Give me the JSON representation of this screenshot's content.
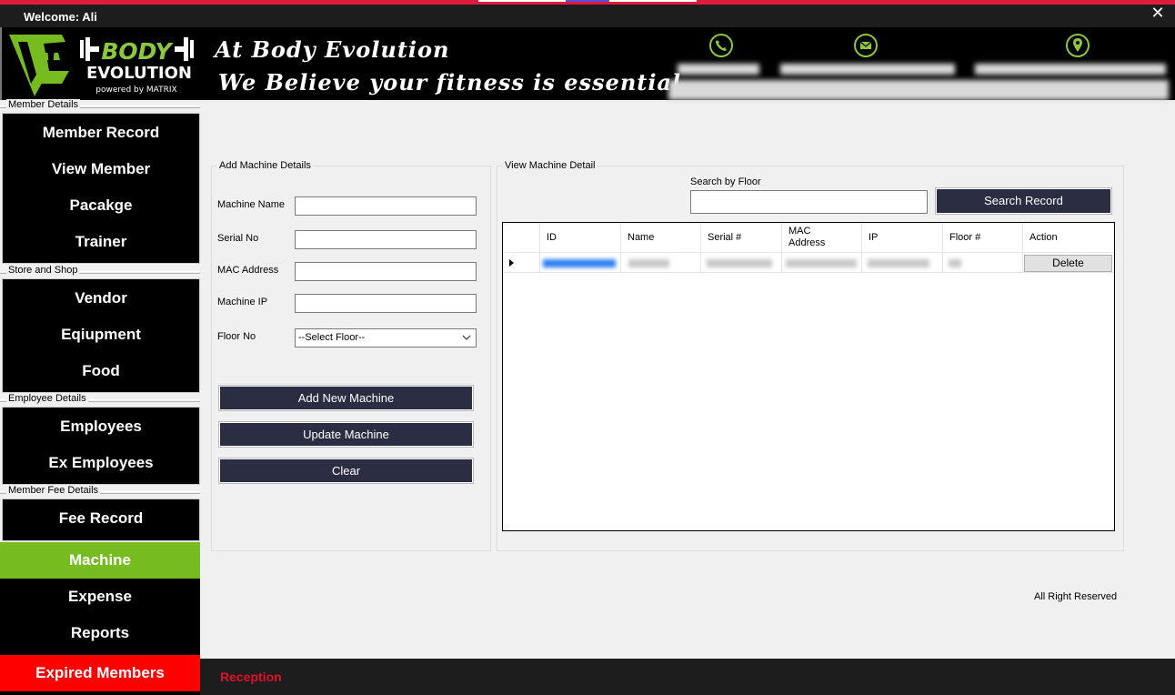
{
  "titlebar": {
    "welcome": "Welcome: Ali",
    "close_glyph": "✕"
  },
  "header": {
    "logo": {
      "word1": "BODY",
      "word2": "EVOLUTION",
      "tagline": "powered by MATRIX",
      "icon": "be-monogram-dumbbell-logo"
    },
    "slogan_line1": "At Body Evolution",
    "slogan_line2": "We Believe your fitness is essential",
    "contact_icons": [
      "phone-icon",
      "mail-icon",
      "location-icon"
    ],
    "accent_color": "#8dc63f"
  },
  "sidebar": {
    "member_details": {
      "label": "Member Details",
      "items": [
        "Member Record",
        "View Member",
        "Pacakge",
        "Trainer"
      ]
    },
    "store_shop": {
      "label": "Store and Shop",
      "items": [
        "Vendor",
        "Eqiupment",
        "Food"
      ]
    },
    "employee_details": {
      "label": "Employee Details",
      "items": [
        "Employees",
        "Ex Employees"
      ]
    },
    "member_fee": {
      "label": "Member Fee Details",
      "items": [
        "Fee Record"
      ]
    },
    "machine": "Machine",
    "expense": "Expense",
    "reports": "Reports",
    "expired": "Expired Members",
    "active_color": "#76bc21",
    "expired_color": "#ff0000"
  },
  "add_panel": {
    "legend": "Add Machine Details",
    "fields": {
      "machine_name": {
        "label": "Machine Name",
        "value": ""
      },
      "serial_no": {
        "label": "Serial No",
        "value": ""
      },
      "mac_address": {
        "label": "MAC Address",
        "value": ""
      },
      "machine_ip": {
        "label": "Machine IP",
        "value": ""
      },
      "floor_no": {
        "label": "Floor No",
        "selected": "--Select Floor--"
      }
    },
    "buttons": {
      "add": "Add New Machine",
      "update": "Update Machine",
      "clear": "Clear"
    }
  },
  "view_panel": {
    "legend": "View Machine Detail",
    "search_label": "Search by Floor",
    "search_value": "",
    "search_button": "Search Record",
    "columns": [
      "ID",
      "Name",
      "Serial #",
      "MAC\nAddress",
      "IP",
      "Floor #",
      "Action"
    ],
    "row_action": "Delete"
  },
  "footer": {
    "rights": "All Right Reserved",
    "role": "Reception"
  }
}
